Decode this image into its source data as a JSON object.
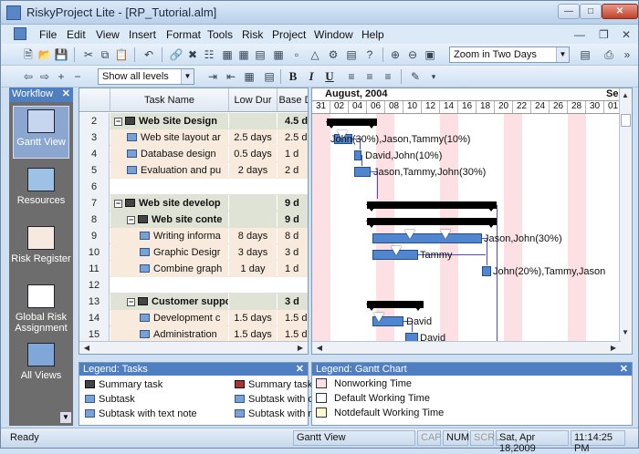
{
  "title": "RiskyProject Lite - [RP_Tutorial.alm]",
  "menu": [
    "File",
    "Edit",
    "View",
    "Insert",
    "Format",
    "Tools",
    "Risk",
    "Project",
    "Window",
    "Help"
  ],
  "toolbar": {
    "zoom": "Zoom in Two Days",
    "levels": "Show all levels"
  },
  "workflow": {
    "header": "Workflow",
    "items": [
      {
        "label": "Gantt View",
        "icon": "gantt-icon"
      },
      {
        "label": "Resources",
        "icon": "resources-icon"
      },
      {
        "label": "Risk Register",
        "icon": "risk-register-icon"
      },
      {
        "label": "Global Risk Assignment",
        "icon": "global-risk-icon"
      },
      {
        "label": "All Views",
        "icon": "all-views-icon"
      }
    ]
  },
  "grid": {
    "headers": {
      "name": "Task Name",
      "low": "Low Dur",
      "base": "Base D"
    },
    "rows": [
      {
        "n": "2",
        "name": "Web Site Design",
        "low": "",
        "base": "4.5 d",
        "type": "summary",
        "indent": 0
      },
      {
        "n": "3",
        "name": "Web site layout ar",
        "low": "2.5 days",
        "base": "2.5 d",
        "type": "task",
        "indent": 1
      },
      {
        "n": "4",
        "name": "Database design",
        "low": "0.5 days",
        "base": "1 d",
        "type": "task",
        "indent": 1
      },
      {
        "n": "5",
        "name": "Evaluation and pu",
        "low": "2 days",
        "base": "2 d",
        "type": "task",
        "indent": 1
      },
      {
        "n": "6",
        "name": "",
        "low": "",
        "base": "",
        "type": "empty",
        "indent": 0
      },
      {
        "n": "7",
        "name": "Web site develop",
        "low": "",
        "base": "9 d",
        "type": "summary",
        "indent": 0
      },
      {
        "n": "8",
        "name": "Web site conte",
        "low": "",
        "base": "9 d",
        "type": "summary",
        "indent": 1
      },
      {
        "n": "9",
        "name": "Writing informa",
        "low": "8 days",
        "base": "8 d",
        "type": "task",
        "indent": 2
      },
      {
        "n": "10",
        "name": "Graphic Desigr",
        "low": "3 days",
        "base": "3 d",
        "type": "task",
        "indent": 2
      },
      {
        "n": "11",
        "name": "Combine graph",
        "low": "1 day",
        "base": "1 d",
        "type": "task",
        "indent": 2
      },
      {
        "n": "12",
        "name": "",
        "low": "",
        "base": "",
        "type": "empty",
        "indent": 0
      },
      {
        "n": "13",
        "name": "Customer suppo",
        "low": "",
        "base": "3 d",
        "type": "summary",
        "indent": 1
      },
      {
        "n": "14",
        "name": "Development c",
        "low": "1.5 days",
        "base": "1.5 d",
        "type": "task",
        "indent": 2
      },
      {
        "n": "15",
        "name": "Administration",
        "low": "1.5 days",
        "base": "1.5 d",
        "type": "task",
        "indent": 2
      }
    ]
  },
  "gantt": {
    "months": [
      "August, 2004",
      "Se"
    ],
    "days": [
      "31",
      "02",
      "04",
      "06",
      "08",
      "10",
      "12",
      "14",
      "16",
      "18",
      "20",
      "22",
      "24",
      "26",
      "28",
      "30",
      "01"
    ],
    "resources": [
      "John(30%),Jason,Tammy(10%)",
      "David,John(10%)",
      "Jason,Tammy,John(30%)",
      "Jason,John(30%)",
      "Tammy",
      "John(20%),Tammy,Jason",
      "David",
      "David"
    ]
  },
  "legend_tasks": {
    "header": "Legend: Tasks",
    "items": [
      "Summary task",
      "Subtask",
      "Subtask with text note",
      "Summary task",
      "Subtask with c",
      "Subtask with r"
    ]
  },
  "legend_gantt": {
    "header": "Legend: Gantt Chart",
    "items": [
      "Nonworking Time",
      "Default Working Time",
      "Notdefault Working Time"
    ]
  },
  "status": {
    "ready": "Ready",
    "view": "Gantt View",
    "cap": "CAP",
    "num": "NUM",
    "scrl": "SCRL",
    "date": "Sat, Apr 18,2009",
    "time": "11:14:25 PM"
  }
}
